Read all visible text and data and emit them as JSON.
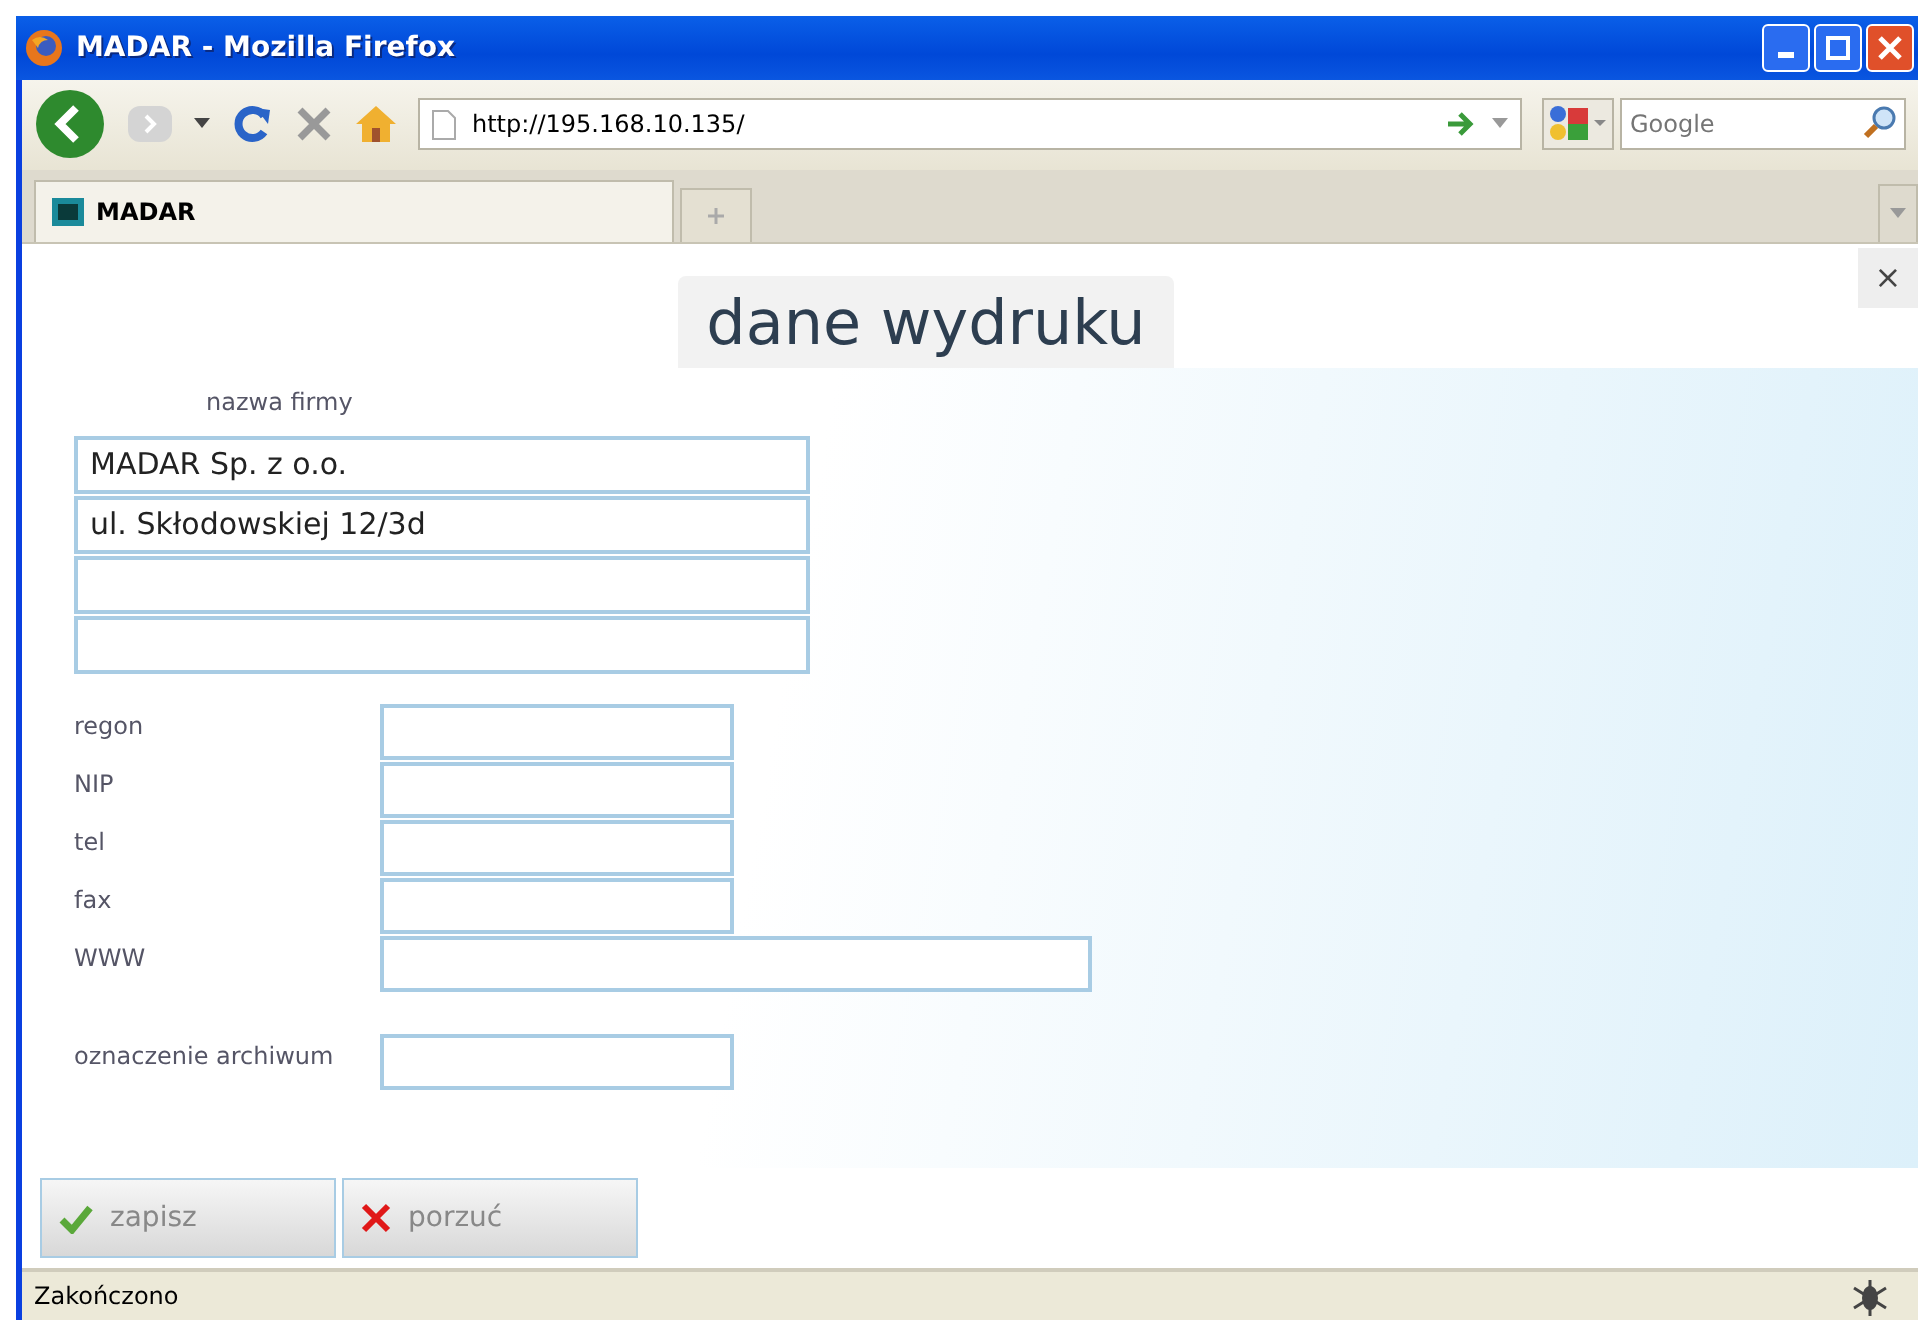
{
  "window": {
    "title": "MADAR - Mozilla Firefox"
  },
  "toolbar": {
    "url": "http://195.168.10.135/",
    "search_placeholder": "Google"
  },
  "tabs": [
    {
      "label": "MADAR",
      "selected": true
    }
  ],
  "dialog": {
    "title": "dane wydruku",
    "close": "×",
    "company_label": "nazwa firmy",
    "company_lines": [
      {
        "filled": true,
        "value": "MADAR Sp. z o.o."
      },
      {
        "filled": true,
        "value": "ul. Skłodowskiej 12/3d"
      },
      {
        "filled": false
      },
      {
        "filled": false
      }
    ],
    "fields": [
      {
        "label": "regon",
        "kind": "short"
      },
      {
        "label": "NIP",
        "kind": "short"
      },
      {
        "label": "tel",
        "kind": "short"
      },
      {
        "label": "fax",
        "kind": "short"
      },
      {
        "label": "WWW",
        "kind": "long"
      }
    ],
    "archive_field": {
      "label": "oznaczenie archiwum"
    },
    "buttons": [
      {
        "label": "zapisz",
        "kind": "save"
      },
      {
        "label": "porzuć",
        "kind": "cancel"
      }
    ]
  },
  "status_bar": {
    "text": "Zakończono"
  }
}
